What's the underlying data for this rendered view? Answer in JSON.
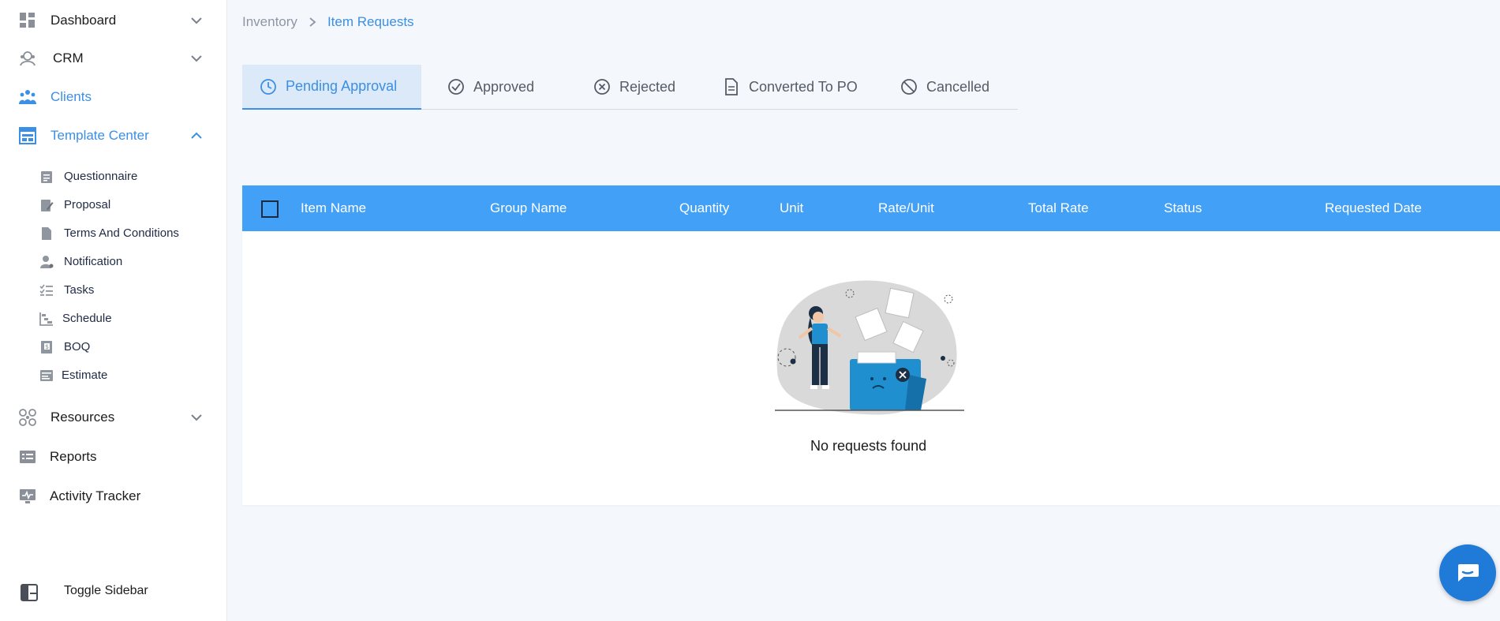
{
  "sidebar": {
    "items": [
      {
        "label": "Dashboard",
        "icon": "dashboard-icon",
        "expandable": true,
        "expanded": false
      },
      {
        "label": "CRM",
        "icon": "crm-icon",
        "expandable": true,
        "expanded": false
      },
      {
        "label": "Clients",
        "icon": "clients-icon",
        "expandable": false,
        "active": true
      },
      {
        "label": "Template Center",
        "icon": "template-icon",
        "expandable": true,
        "expanded": true,
        "active": true
      },
      {
        "label": "Resources",
        "icon": "resources-icon",
        "expandable": true,
        "expanded": false
      },
      {
        "label": "Reports",
        "icon": "reports-icon",
        "expandable": false
      },
      {
        "label": "Activity Tracker",
        "icon": "activity-icon",
        "expandable": false
      }
    ],
    "template_center_children": [
      {
        "label": "Questionnaire",
        "icon": "questionnaire-icon"
      },
      {
        "label": "Proposal",
        "icon": "proposal-icon"
      },
      {
        "label": "Terms And Conditions",
        "icon": "document-icon"
      },
      {
        "label": "Notification",
        "icon": "user-icon"
      },
      {
        "label": "Tasks",
        "icon": "tasks-icon"
      },
      {
        "label": "Schedule",
        "icon": "schedule-icon"
      },
      {
        "label": "BOQ",
        "icon": "boq-icon"
      },
      {
        "label": "Estimate",
        "icon": "estimate-icon"
      }
    ],
    "toggle_label": "Toggle Sidebar"
  },
  "breadcrumb": {
    "parent": "Inventory",
    "current": "Item Requests"
  },
  "tabs": [
    {
      "label": "Pending Approval",
      "icon": "clock-icon",
      "active": true
    },
    {
      "label": "Approved",
      "icon": "check-circle-icon",
      "active": false
    },
    {
      "label": "Rejected",
      "icon": "x-circle-icon",
      "active": false
    },
    {
      "label": "Converted To PO",
      "icon": "file-icon",
      "active": false
    },
    {
      "label": "Cancelled",
      "icon": "ban-icon",
      "active": false
    }
  ],
  "table": {
    "columns": [
      "Item Name",
      "Group Name",
      "Quantity",
      "Unit",
      "Rate/Unit",
      "Total Rate",
      "Status",
      "Requested Date"
    ],
    "rows": [],
    "empty_message": "No requests found"
  },
  "colors": {
    "accent": "#3b8fe5",
    "table_header": "#42a0f7",
    "active_tab_bg": "#dbe9f8",
    "page_bg": "#f4f7fc"
  },
  "chat": {
    "icon": "chat-icon"
  }
}
